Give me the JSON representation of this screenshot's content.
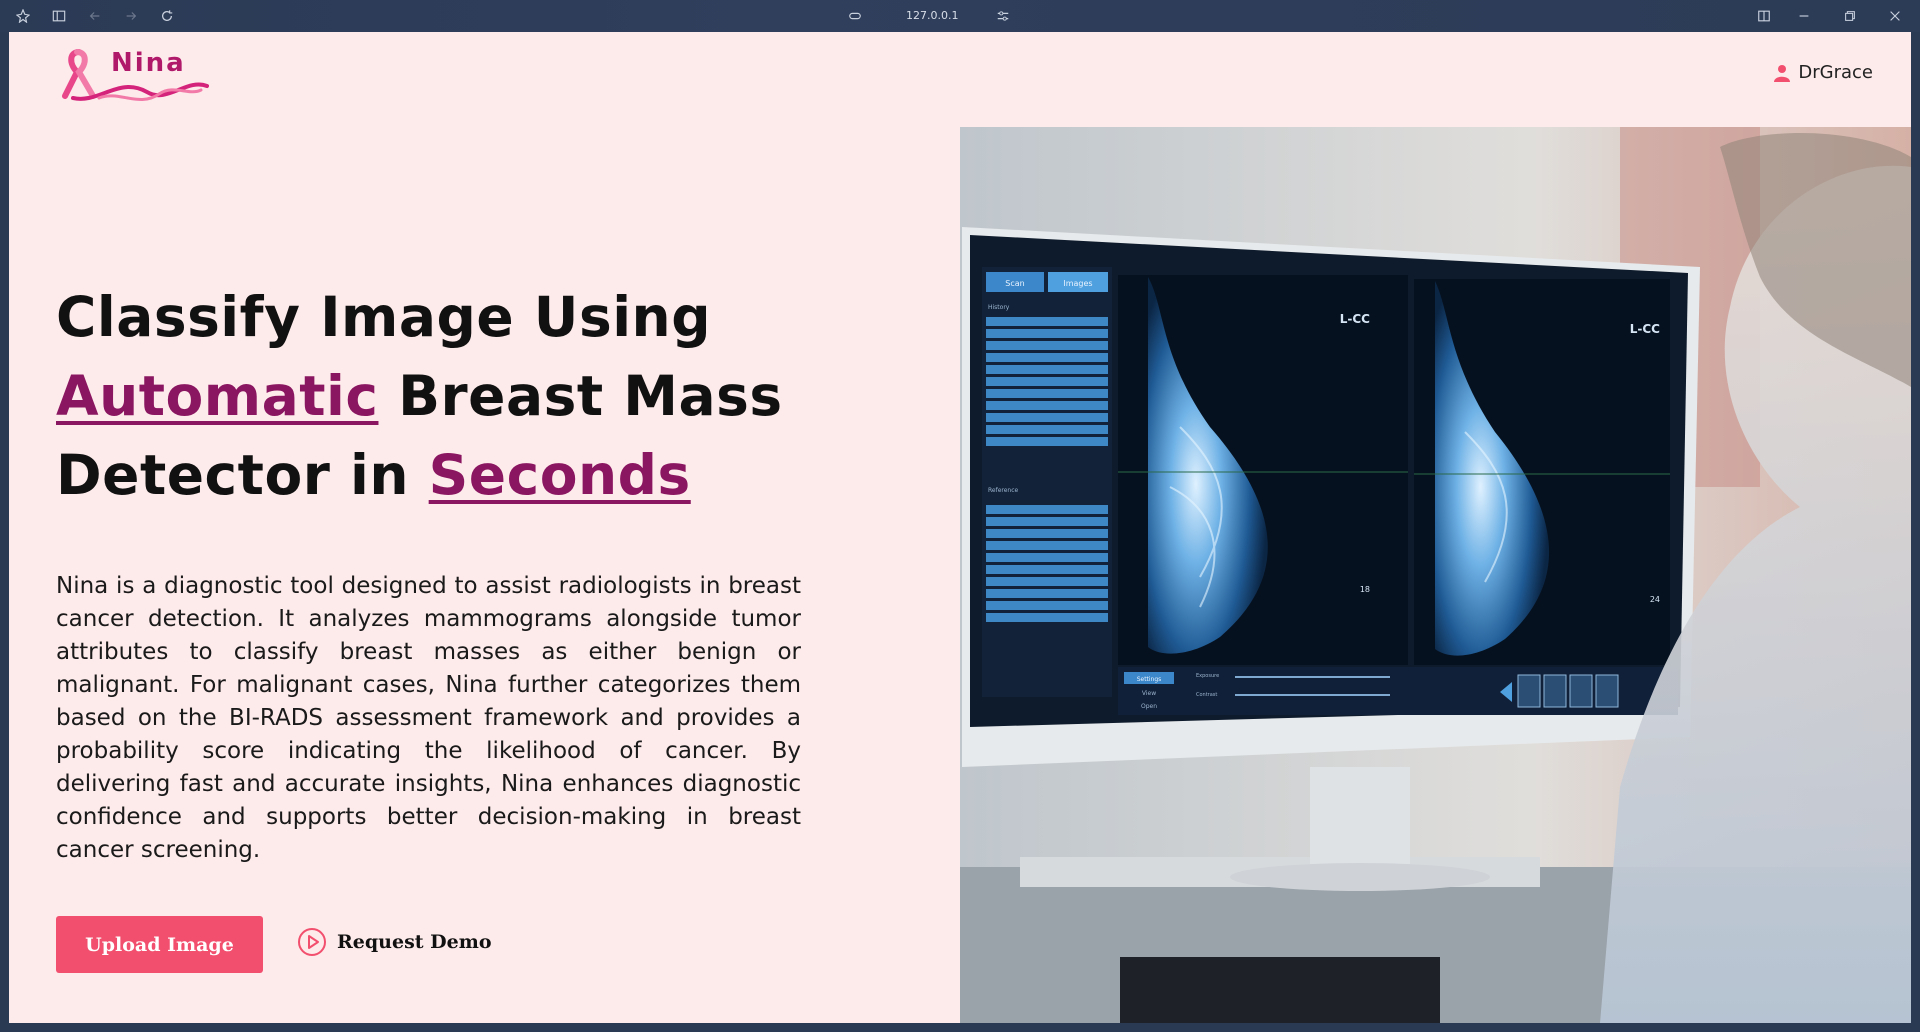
{
  "browser": {
    "url": "127.0.0.1"
  },
  "header": {
    "logo_text": "Nina",
    "user_name": "DrGrace"
  },
  "hero": {
    "title_line1": "Classify Image Using",
    "title_highlight1": "Automatic",
    "title_line2_rest": " Breast Mass",
    "title_line3_start": "Detector in ",
    "title_highlight2": "Seconds",
    "description": "Nina is a diagnostic tool designed to assist radiologists in breast cancer detection. It analyzes mammograms alongside tumor attributes to classify breast masses as either benign or malignant. For malignant cases, Nina further categorizes them based on the BI-RADS assessment framework and provides a probability score indicating the likelihood of cancer. By delivering fast and accurate insights, Nina enhances diagnostic confidence and supports better decision-making in breast cancer screening.",
    "upload_label": "Upload Image",
    "demo_label": "Request Demo"
  },
  "monitor": {
    "tab_scan": "Scan",
    "tab_images": "Images",
    "history_label": "History",
    "reference_label": "Reference",
    "view_left_label": "L-CC",
    "view_right_label": "L-CC",
    "frame_left": "18",
    "frame_right": "24",
    "ctrl_settings": "Settings",
    "ctrl_view": "View",
    "ctrl_open": "Open",
    "ctrl_exposure": "Exposure",
    "ctrl_contrast": "Contrast"
  },
  "colors": {
    "page_bg": "#fdeaea",
    "accent": "#8a1560",
    "button": "#f24f6e",
    "user_icon": "#f24f6e"
  }
}
